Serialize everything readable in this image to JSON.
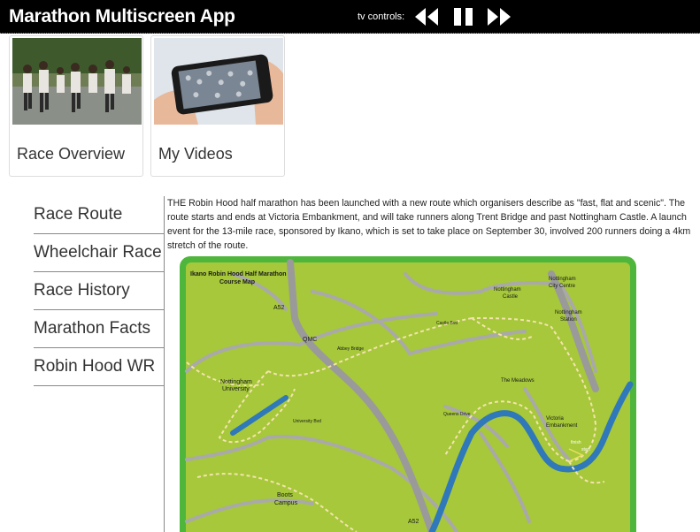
{
  "app": {
    "title": "Marathon Multiscreen App"
  },
  "tv_controls": {
    "label": "tv controls:",
    "buttons": [
      "rewind-icon",
      "pause-icon",
      "fast-forward-icon"
    ]
  },
  "cards": [
    {
      "label": "Race Overview",
      "image": "runners-photo"
    },
    {
      "label": "My Videos",
      "image": "phone-filming-crowd-photo"
    }
  ],
  "nav": {
    "items": [
      {
        "label": "Race Route"
      },
      {
        "label": "Wheelchair Race"
      },
      {
        "label": "Race History"
      },
      {
        "label": "Marathon Facts"
      },
      {
        "label": "Robin Hood WR"
      }
    ]
  },
  "article": {
    "text": "THE Robin Hood half marathon has been launched with a new route which organisers describe as \"fast, flat and scenic\". The route starts and ends at Victoria Embankment, and will take runners along Trent Bridge and past Nottingham Castle. A launch event for the 13-mile race, sponsored by Ikano, which is set to take place on September 30, involved 200 runners doing a 4km stretch of the route."
  },
  "map": {
    "title_line1": "Ikano Robin Hood Half Marathon",
    "title_line2": "Course Map",
    "labels": {
      "a52_top": "A52",
      "qmc": "QMC",
      "uni1": "Nottingham",
      "uni2": "University",
      "univ_blvd": "University Bvd",
      "abbey": "Abbey Bridge",
      "castle_bvd": "Castle Bvd",
      "castle1": "Nottingham",
      "castle2": "Castle",
      "city1": "Nottingham",
      "city2": "City Centre",
      "station1": "Nottingham",
      "station2": "Station",
      "meadows": "The Meadows",
      "queens": "Queens Drive",
      "victoria1": "Victoria",
      "victoria2": "Embankment",
      "finish": "finish",
      "start": "start",
      "boots1": "Boots",
      "boots2": "Campus",
      "a52_bottom": "A52"
    },
    "colors": {
      "frame": "#4fb63c",
      "land": "#a6c83a",
      "road": "#a9a9a9",
      "river": "#2f78b9",
      "route": "#f4e3b0"
    }
  }
}
